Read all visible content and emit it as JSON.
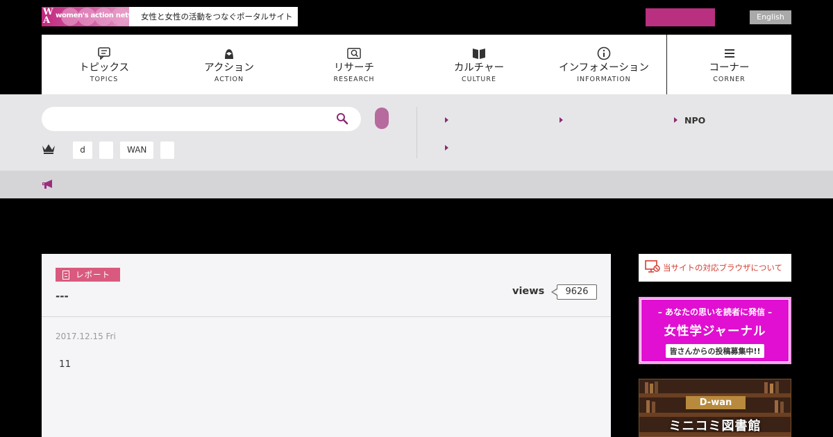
{
  "header": {
    "logo_text": "women's action network",
    "tagline": "女性と女性の活動をつなぐポータルサイト",
    "english_label": "English"
  },
  "nav": {
    "items": [
      {
        "label": "トピックス",
        "sub": "TOPICS",
        "icon": "speech-bubble-icon"
      },
      {
        "label": "アクション",
        "sub": "ACTION",
        "icon": "person-icon"
      },
      {
        "label": "リサーチ",
        "sub": "RESEARCH",
        "icon": "magnifier-icon"
      },
      {
        "label": "カルチャー",
        "sub": "CULTURE",
        "icon": "book-icon"
      },
      {
        "label": "インフォメーション",
        "sub": "INFORMATION",
        "icon": "info-icon"
      },
      {
        "label": "コーナー",
        "sub": "CORNER",
        "icon": "menu-icon"
      }
    ]
  },
  "search": {
    "placeholder": "",
    "tags": [
      "d",
      "",
      "WAN",
      ""
    ],
    "links": [
      "",
      "",
      "NPO",
      ""
    ]
  },
  "article": {
    "category": "レポート",
    "title": "---",
    "views_label": "views",
    "views_count": "9626",
    "date": "2017.12.15 Fri",
    "body": "11"
  },
  "sidebar": {
    "browser_notice": "当サイトの対応ブラウザについて",
    "journal": {
      "line1": "– あなたの思いを読者に発信 –",
      "line2": "女性学ジャーナル",
      "line3": "皆さんからの投稿募集中!!"
    },
    "dwan": {
      "tag": "D-wan",
      "title": "ミニコミ図書館"
    }
  },
  "colors": {
    "brand_magenta": "#b8307f",
    "badge_pink": "#d95a7e",
    "journal_magenta": "#e10fd1"
  }
}
